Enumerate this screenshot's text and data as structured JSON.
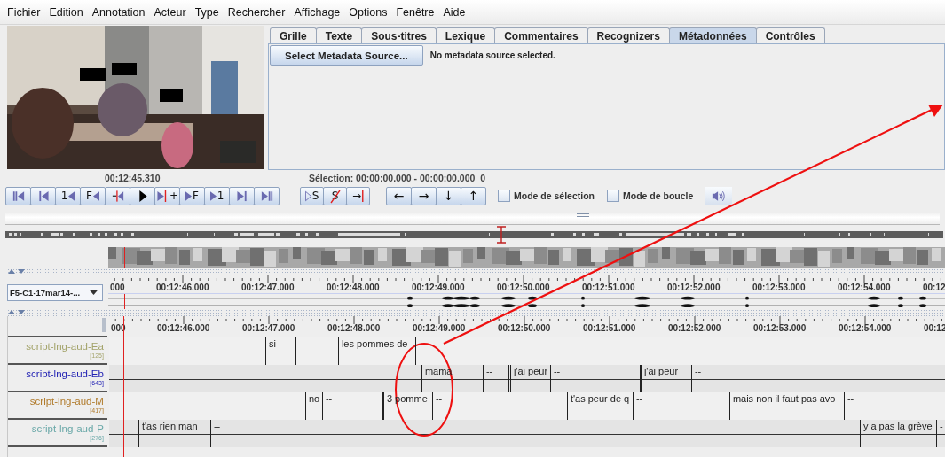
{
  "menu": [
    {
      "label": "Fichier"
    },
    {
      "label": "Edition"
    },
    {
      "label": "Annotation"
    },
    {
      "label": "Acteur"
    },
    {
      "label": "Type"
    },
    {
      "label": "Rechercher"
    },
    {
      "label": "Affichage"
    },
    {
      "label": "Options"
    },
    {
      "label": "Fenêtre"
    },
    {
      "label": "Aide"
    }
  ],
  "tabs": [
    {
      "label": "Grille",
      "selected": false
    },
    {
      "label": "Texte",
      "selected": false
    },
    {
      "label": "Sous-titres",
      "selected": false
    },
    {
      "label": "Lexique",
      "selected": false
    },
    {
      "label": "Commentaires",
      "selected": false
    },
    {
      "label": "Recognizers",
      "selected": false
    },
    {
      "label": "Métadonnées",
      "selected": true
    },
    {
      "label": "Contrôles",
      "selected": false
    }
  ],
  "metadata": {
    "button": "Select Metadata Source...",
    "status": "No metadata source selected."
  },
  "player": {
    "time": "00:12:45.310",
    "selection": "Sélection: 00:00:00.000 - 00:00:00.000",
    "selection_count": "0"
  },
  "transport": [
    {
      "kind": "bars-left"
    },
    {
      "kind": "bar-left"
    },
    {
      "kind": "label-left",
      "label": "1"
    },
    {
      "kind": "label-left",
      "label": "F"
    },
    {
      "kind": "redbar-left"
    },
    {
      "kind": "play"
    },
    {
      "kind": "right-redbar",
      "label": "+"
    },
    {
      "kind": "right-label",
      "label": "F"
    },
    {
      "kind": "right-label",
      "label": "1"
    },
    {
      "kind": "right-bar"
    },
    {
      "kind": "right-bars"
    }
  ],
  "selection_buttons": [
    {
      "kind": "play-selection",
      "label": "S"
    },
    {
      "kind": "clear-selection",
      "label": "S"
    },
    {
      "kind": "to-selection",
      "label": "→"
    }
  ],
  "arrow_buttons": [
    {
      "label": "←"
    },
    {
      "label": "→"
    },
    {
      "label": "↓"
    },
    {
      "label": "↑"
    }
  ],
  "checkboxes": [
    {
      "label": "Mode de sélection",
      "checked": false
    },
    {
      "label": "Mode de boucle",
      "checked": false
    }
  ],
  "waveform": {
    "dropdown": "F5-C1-17mar14-...",
    "ruler": [
      "000",
      "00:12:46.000",
      "00:12:47.000",
      "00:12:48.000",
      "00:12:49.000",
      "00:12:50.000",
      "00:12:51.000",
      "00:12:52.000",
      "00:12:53.000",
      "00:12:54.000",
      "00:12"
    ]
  },
  "tiers_panel": {
    "ruler": [
      "000",
      "00:12:46.000",
      "00:12:47.000",
      "00:12:48.000",
      "00:12:49.000",
      "00:12:50.000",
      "00:12:51.000",
      "00:12:52.000",
      "00:12:53.000",
      "00:12:54.000",
      "00:12"
    ],
    "tiers": [
      {
        "name": "script-lng-aud-Ea",
        "count": "[125]",
        "color": "#a3a36a",
        "annotations": [
          {
            "text": "si"
          },
          {
            "text": "--"
          },
          {
            "text": "les pommes de"
          },
          {
            "text": "--"
          }
        ]
      },
      {
        "name": "script-lng-aud-Eb",
        "count": "[643]",
        "color": "#2424b4",
        "annotations": [
          {
            "text": "mama"
          },
          {
            "text": "--"
          },
          {
            "text": "j'ai peur"
          },
          {
            "text": "--"
          },
          {
            "text": "j'ai peur"
          },
          {
            "text": "--"
          }
        ]
      },
      {
        "name": "script-lng-aud-M",
        "count": "[417]",
        "color": "#b07a2a",
        "annotations": [
          {
            "text": "no"
          },
          {
            "text": "--"
          },
          {
            "text": "3 pomme"
          },
          {
            "text": "--"
          },
          {
            "text": "t'as peur de q"
          },
          {
            "text": "--"
          },
          {
            "text": "mais non il faut pas avo"
          },
          {
            "text": "--"
          }
        ]
      },
      {
        "name": "script-lng-aud-P",
        "count": "[276]",
        "color": "#6aa8a8",
        "annotations": [
          {
            "text": "t'as rien man"
          },
          {
            "text": "--"
          },
          {
            "text": "y a pas la grève"
          },
          {
            "text": "-"
          }
        ]
      }
    ]
  }
}
